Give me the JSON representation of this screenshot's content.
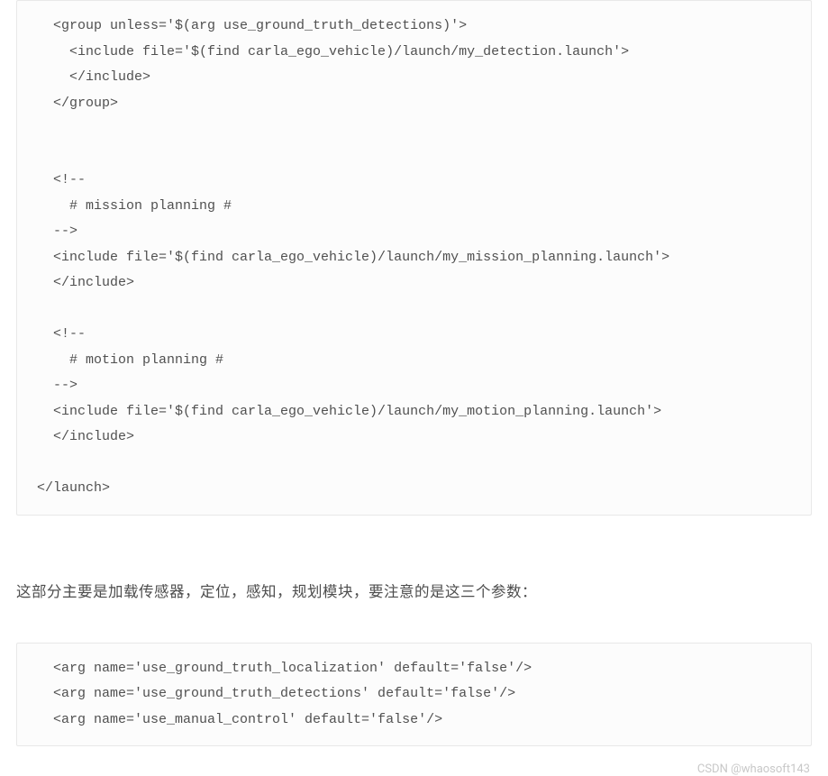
{
  "code_block_1": "  <group unless='$(arg use_ground_truth_detections)'>\n    <include file='$(find carla_ego_vehicle)/launch/my_detection.launch'>\n    </include>\n  </group>\n\n\n  <!--\n    # mission planning #\n  -->\n  <include file='$(find carla_ego_vehicle)/launch/my_mission_planning.launch'>\n  </include>\n\n  <!--\n    # motion planning #\n  -->\n  <include file='$(find carla_ego_vehicle)/launch/my_motion_planning.launch'>\n  </include>\n\n</launch>",
  "paragraph_1": "这部分主要是加载传感器，定位，感知，规划模块，要注意的是这三个参数：",
  "code_block_2": "  <arg name='use_ground_truth_localization' default='false'/>\n  <arg name='use_ground_truth_detections' default='false'/>\n  <arg name='use_manual_control' default='false'/>",
  "watermark": "CSDN @whaosoft143"
}
